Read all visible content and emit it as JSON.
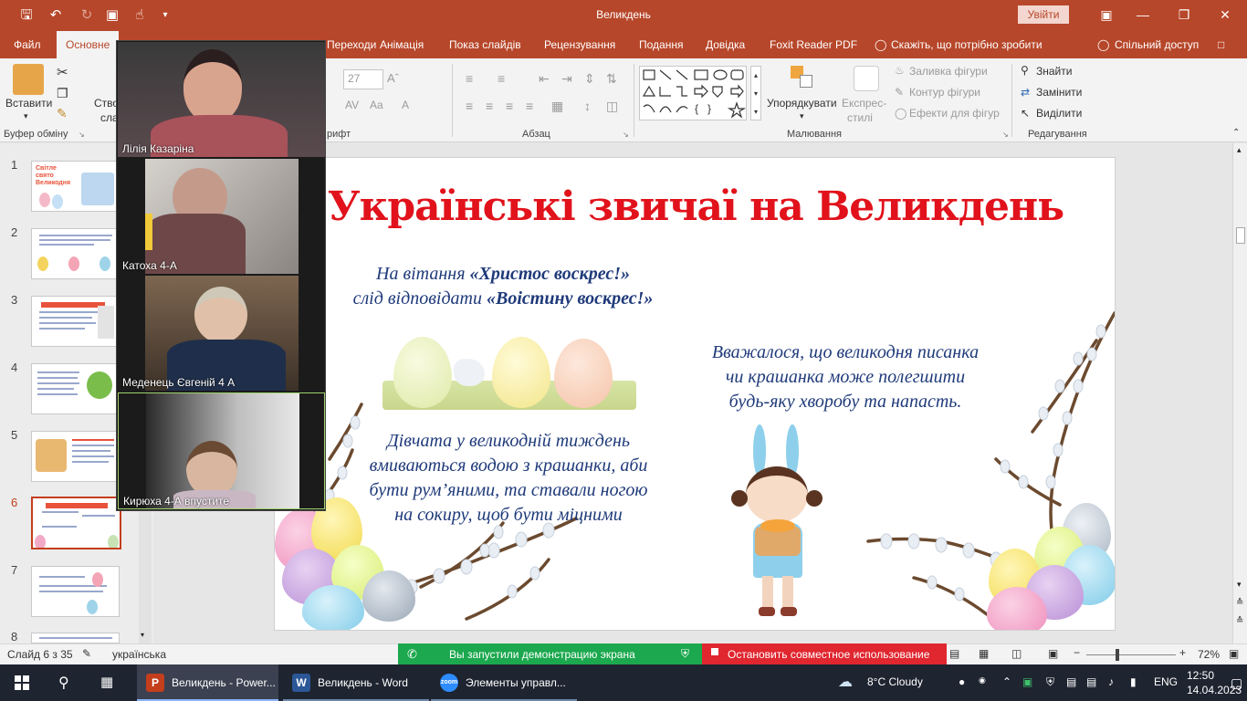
{
  "window": {
    "title": "Великдень",
    "signin_label": "Увійти"
  },
  "tabs": [
    {
      "label": "Файл"
    },
    {
      "label": "Основне"
    },
    {
      "label": "Переходи"
    },
    {
      "label": "Анімація"
    },
    {
      "label": "Показ слайдів"
    },
    {
      "label": "Рецензування"
    },
    {
      "label": "Подання"
    },
    {
      "label": "Довідка"
    },
    {
      "label": "Foxit Reader PDF"
    }
  ],
  "tell_me": "Скажіть, що потрібно зробити",
  "share_label": "Спільний доступ",
  "ribbon": {
    "paste_label": "Вставити",
    "new_slide_label_1": "Ство",
    "new_slide_label_2": "сла",
    "clipboard_group": "Буфер обміну",
    "font_group": "рифт",
    "font_size": "27",
    "paragraph_group": "Абзац",
    "arrange_label": "Упорядкувати",
    "quick_styles_label_1": "Експрес-",
    "quick_styles_label_2": "стилі",
    "shape_fill_label": "Заливка фігури",
    "shape_outline_label": "Контур фігури",
    "shape_effects_label": "Ефекти для фігур",
    "drawing_group": "Малювання",
    "find_label": "Знайти",
    "replace_label": "Замінити",
    "select_label": "Виділити",
    "editing_group": "Редагування"
  },
  "thumbnails": [
    {
      "num": "1",
      "text": "Світле свято Великодня"
    },
    {
      "num": "2"
    },
    {
      "num": "3"
    },
    {
      "num": "4"
    },
    {
      "num": "5"
    },
    {
      "num": "6"
    },
    {
      "num": "7"
    },
    {
      "num": "8"
    }
  ],
  "slide": {
    "title": "Українські звичаї на Великдень",
    "greeting_line1_pre": "На вітання ",
    "greeting_line1_bold": "«Христос воскрес!»",
    "greeting_line2_pre": "слід відповідати ",
    "greeting_line2_bold": "«Воістину воскрес!»",
    "belief_line1": "Вважалося, що великодня писанка",
    "belief_line2": "чи крашанка може полегшити",
    "belief_line3": "будь-яку хворобу та напасть.",
    "girls_line1": "Дівчата у великодній тиждень",
    "girls_line2": "вмиваються водою з крашанки, аби",
    "girls_line3": "бути рум’яними, та ставали ногою",
    "girls_line4": "на сокиру, щоб бути міцними"
  },
  "zoom": {
    "participants": [
      {
        "name": "Лілія Казаріна"
      },
      {
        "name": "Катоха 4-А"
      },
      {
        "name": "Меденець Євгеній 4 А"
      },
      {
        "name": "Кирюха 4-А впустите"
      }
    ]
  },
  "status": {
    "slide_info": "Слайд 6 з 35",
    "language": "українська",
    "zoom_level": "72%"
  },
  "share_banner": {
    "message": "Вы запустили демонстрацию экрана",
    "stop_label": "Остановить совместное использование"
  },
  "taskbar": {
    "apps": [
      {
        "label": "Великдень - Power..."
      },
      {
        "label": "Великдень - Word"
      },
      {
        "label": "Элементы управл..."
      }
    ],
    "weather": "8°C  Cloudy",
    "language": "ENG",
    "time": "12:50",
    "date": "14.04.2023"
  },
  "colors": {
    "accent": "#b7472a",
    "slide_title": "#e1121b",
    "slide_text": "#1f3a7a"
  }
}
